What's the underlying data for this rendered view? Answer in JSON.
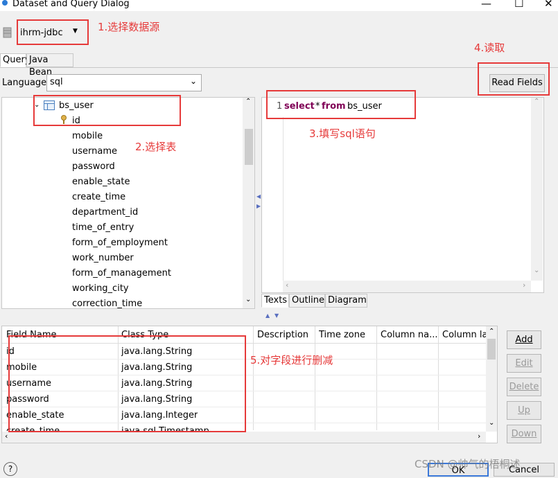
{
  "window": {
    "title": "Dataset and Query Dialog",
    "minimize": "—",
    "maximize": "☐"
  },
  "datasource": {
    "selected": "ihrm-jdbc"
  },
  "tabs": [
    {
      "label": "Query"
    },
    {
      "label": "Java Bean"
    }
  ],
  "language": {
    "label": "Language",
    "value": "sql"
  },
  "read_fields": {
    "label": "Read Fields"
  },
  "tree": {
    "table": "bs_user",
    "columns": [
      "id",
      "mobile",
      "username",
      "password",
      "enable_state",
      "create_time",
      "department_id",
      "time_of_entry",
      "form_of_employment",
      "work_number",
      "form_of_management",
      "working_city",
      "correction_time"
    ]
  },
  "editor": {
    "line_number": "1",
    "kw_select": "select",
    "star": "*",
    "kw_from": "from",
    "table": "bs_user",
    "tabs": [
      "Texts",
      "Outline",
      "Diagram"
    ]
  },
  "grid": {
    "headers": [
      "Field Name",
      "Class Type",
      "Description",
      "Time zone",
      "Column na...",
      "Column la"
    ],
    "rows": [
      [
        "id",
        "java.lang.String"
      ],
      [
        "mobile",
        "java.lang.String"
      ],
      [
        "username",
        "java.lang.String"
      ],
      [
        "password",
        "java.lang.String"
      ],
      [
        "enable_state",
        "java.lang.Integer"
      ],
      [
        "create_time",
        "java.sql.Timestamp"
      ]
    ]
  },
  "side_buttons": [
    "Add",
    "Edit",
    "Delete",
    "Up",
    "Down"
  ],
  "footer": {
    "ok": "OK",
    "cancel": "Cancel",
    "help": "?",
    "watermark": "CSDN @帅气的梧桐述"
  },
  "annotations": {
    "a1": "1.选择数据源",
    "a2": "2.选择表",
    "a3": "3.填写sql语句",
    "a4": "4.读取",
    "a5": "5.对字段进行删减"
  },
  "colors": {
    "annotation": "#e63a3a",
    "keyword": "#7f0055"
  }
}
